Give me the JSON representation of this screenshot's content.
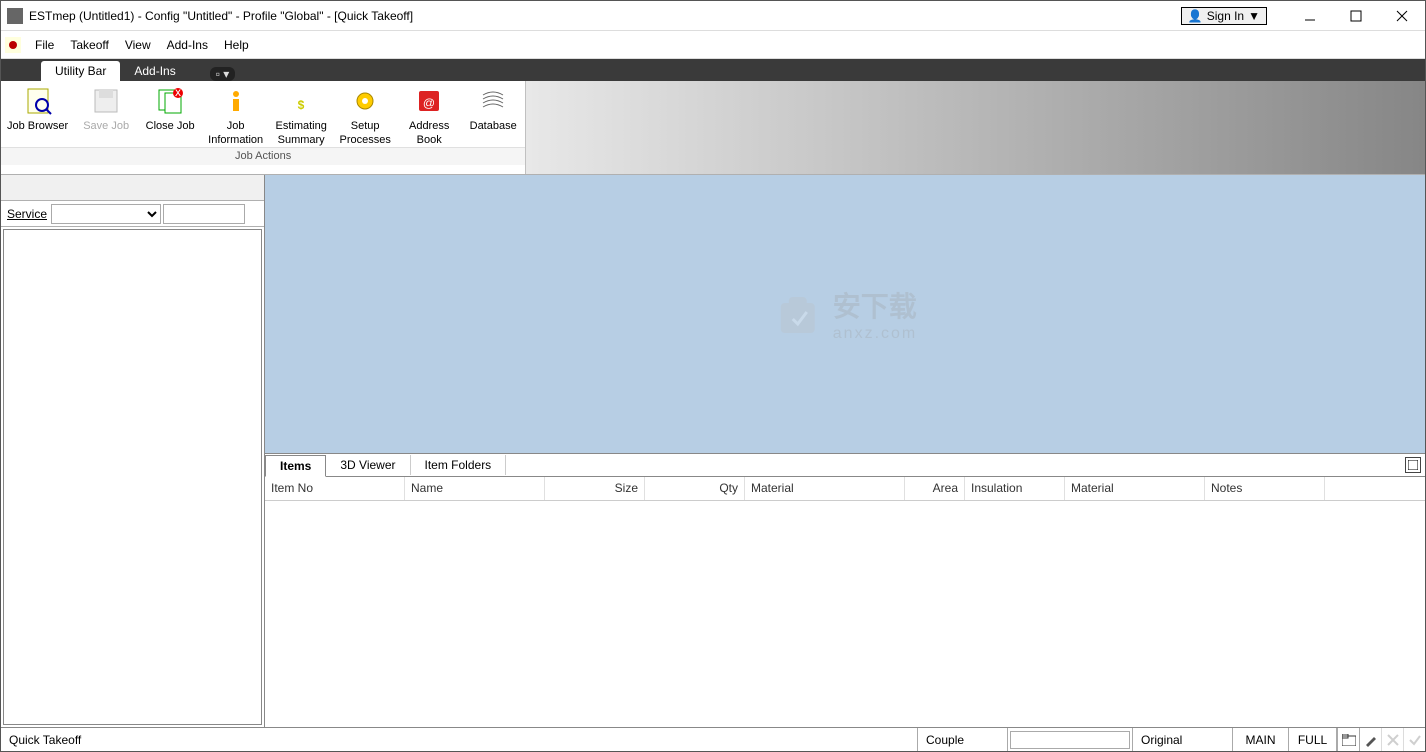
{
  "titlebar": {
    "title": "ESTmep (Untitled1) - Config \"Untitled\" - Profile \"Global\" - [Quick Takeoff]",
    "signin": "Sign In"
  },
  "menu": {
    "items": [
      "File",
      "Takeoff",
      "View",
      "Add-Ins",
      "Help"
    ]
  },
  "tabstrip": {
    "utility": "Utility Bar",
    "addins": "Add-Ins"
  },
  "ribbon": {
    "buttons": [
      {
        "label": "Job Browser"
      },
      {
        "label": "Save Job",
        "disabled": true
      },
      {
        "label": "Close Job"
      },
      {
        "label": "Job\nInformation"
      },
      {
        "label": "Estimating\nSummary"
      },
      {
        "label": "Setup\nProcesses"
      },
      {
        "label": "Address\nBook"
      },
      {
        "label": "Database"
      }
    ],
    "panel_title": "Job Actions"
  },
  "left": {
    "service_label": "Service"
  },
  "bottom_tabs": {
    "items": "Items",
    "viewer": "3D Viewer",
    "folders": "Item Folders"
  },
  "grid": {
    "columns": [
      "Item No",
      "Name",
      "Size",
      "Qty",
      "Material",
      "Area",
      "Insulation",
      "Material",
      "Notes"
    ]
  },
  "status": {
    "mode": "Quick Takeoff",
    "couple": "Couple",
    "original": "Original",
    "main": "MAIN",
    "full": "FULL"
  },
  "watermark": {
    "text": "安下载",
    "sub": "anxz.com"
  }
}
